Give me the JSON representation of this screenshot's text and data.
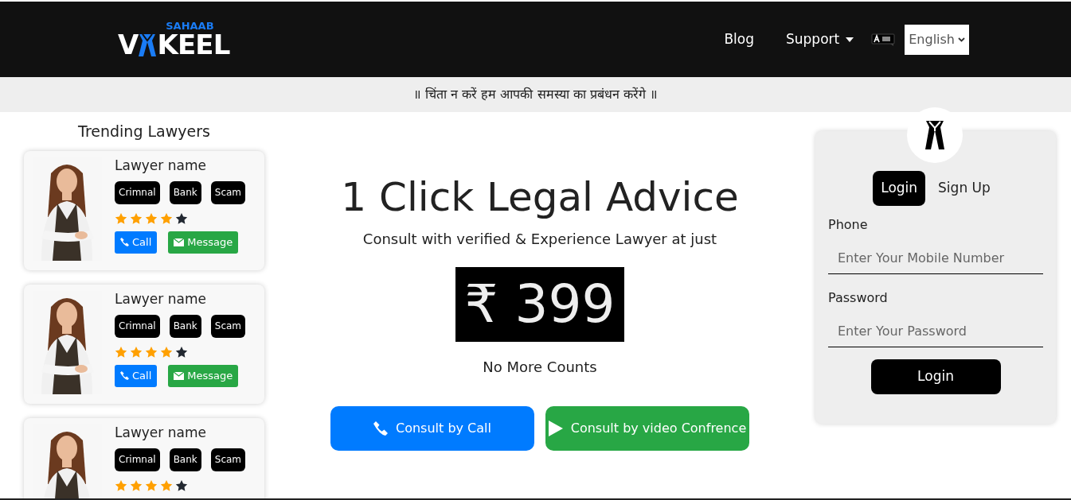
{
  "logo": {
    "top": "SAHAAB",
    "left": "V",
    "right": "KEEL"
  },
  "nav": [
    {
      "label": "Blog",
      "dropdown": false
    },
    {
      "label": "Support",
      "dropdown": true
    }
  ],
  "language": {
    "value": "English"
  },
  "banner": "॥ चिंता न करें हम आपकी समस्या का प्रबंधन करेंगे ॥",
  "trending": {
    "title": "Trending Lawyers",
    "lawyers": [
      {
        "name": "Lawyer name",
        "tags": [
          "Crimnal",
          "Bank",
          "Scam"
        ],
        "stars": 4,
        "buttons": [
          "Call",
          "Message"
        ]
      },
      {
        "name": "Lawyer name",
        "tags": [
          "Crimnal",
          "Bank",
          "Scam"
        ],
        "stars": 4,
        "buttons": [
          "Call",
          "Message"
        ]
      },
      {
        "name": "Lawyer name",
        "tags": [
          "Crimnal",
          "Bank",
          "Scam"
        ],
        "stars": 4
      }
    ]
  },
  "hero": {
    "title": "1 Click Legal Advice",
    "subtitle": "Consult with verified & Experience Lawyer at just",
    "price": "₹ 399",
    "note": "No More Counts",
    "actions": [
      {
        "kind": "call",
        "label": "Consult by Call"
      },
      {
        "kind": "video",
        "label": "Consult by video Confrence"
      }
    ]
  },
  "auth": {
    "tabs": [
      {
        "label": "Login",
        "selected": true
      },
      {
        "label": "Sign Up",
        "selected": false
      }
    ],
    "fields": [
      {
        "label": "Phone",
        "placeholder": "Enter Your Mobile Number"
      },
      {
        "label": "Password",
        "placeholder": "Enter Your Password"
      }
    ],
    "submit": "Login"
  }
}
